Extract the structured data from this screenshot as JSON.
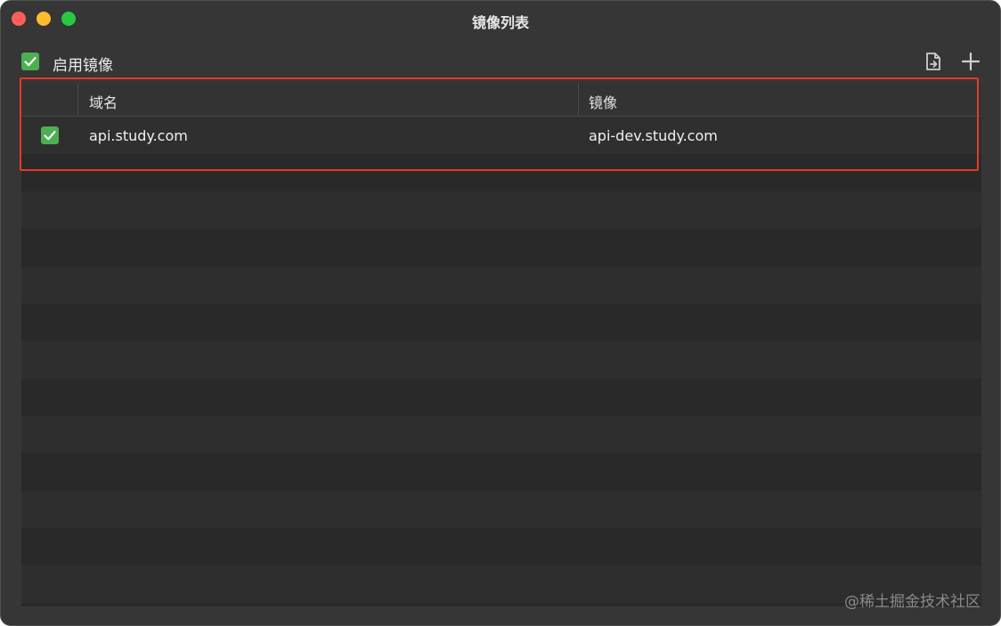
{
  "window": {
    "title": "镜像列表"
  },
  "toolbar": {
    "enable_label": "启用镜像",
    "enable_checked": true,
    "import_icon": "document-import-icon",
    "add_icon": "plus-icon"
  },
  "table": {
    "columns": [
      "",
      "域名",
      "镜像"
    ],
    "rows": [
      {
        "enabled": true,
        "domain": "api.study.com",
        "mirror": "api-dev.study.com"
      }
    ]
  },
  "watermark": "@稀土掘金技术社区",
  "colors": {
    "checkbox": "#4caf50",
    "highlight": "#e33a2a",
    "window_bg": "#363636"
  }
}
